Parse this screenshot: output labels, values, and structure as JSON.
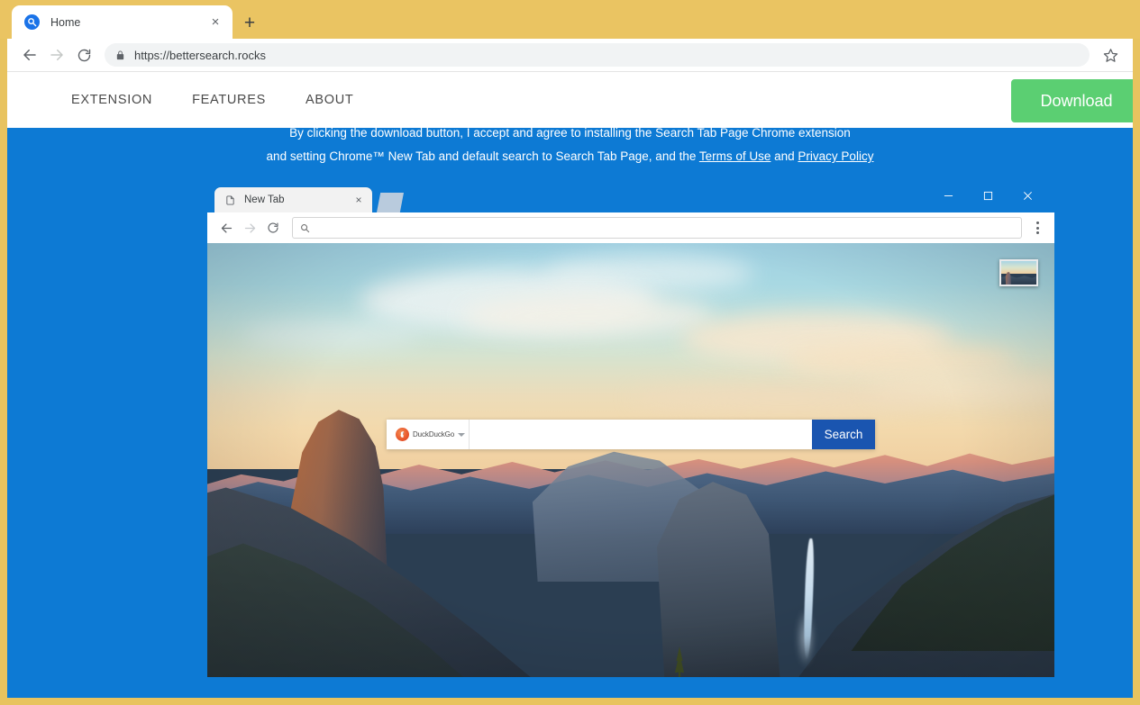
{
  "browser": {
    "tab": {
      "title": "Home",
      "favicon": "search-circle-icon",
      "close": "×"
    },
    "new_tab_label": "+",
    "url": "https://bettersearch.rocks",
    "nav": {
      "back": "back-arrow-icon",
      "forward": "forward-arrow-icon",
      "reload": "reload-icon"
    },
    "lock": "lock-icon",
    "bookmark": "star-icon",
    "tabstrip_color": "#eac462"
  },
  "site": {
    "nav_items": [
      {
        "label": "EXTENSION"
      },
      {
        "label": "FEATURES"
      },
      {
        "label": "ABOUT"
      }
    ],
    "download_label": "Download",
    "download_color": "#5bcf72",
    "background_color": "#0d7ad4",
    "disclaimer": {
      "line1": "By clicking the download button, I accept and agree to installing the Search Tab Page Chrome extension",
      "line2_before": "and setting Chrome™ New Tab and default search to Search Tab Page, and the ",
      "terms_link": "Terms of Use",
      "line2_mid": " and ",
      "privacy_link": "Privacy Policy"
    }
  },
  "mock_browser": {
    "tab": {
      "title": "New Tab",
      "icon": "page-icon",
      "close": "×"
    },
    "new_tab_label": "new-tab-shape",
    "window_controls": {
      "minimize": "—",
      "maximize": "☐",
      "close": "✕"
    },
    "omnibox": {
      "value": "",
      "placeholder": "",
      "icon": "search-icon"
    },
    "menu": "three-dot-menu-icon",
    "nav": {
      "back": "back-arrow-icon",
      "forward": "forward-arrow-icon",
      "reload": "reload-icon"
    }
  },
  "newtab_page": {
    "search": {
      "engine": "DuckDuckGo",
      "engine_logo": "duckduckgo-icon",
      "caret": "chevron-down-icon",
      "query": "",
      "placeholder": "",
      "button_label": "Search",
      "button_color": "#1a55b0"
    },
    "wallpaper": {
      "name": "yosemite-half-dome-sunset",
      "thumbnail_label": "background-thumbnail"
    }
  }
}
